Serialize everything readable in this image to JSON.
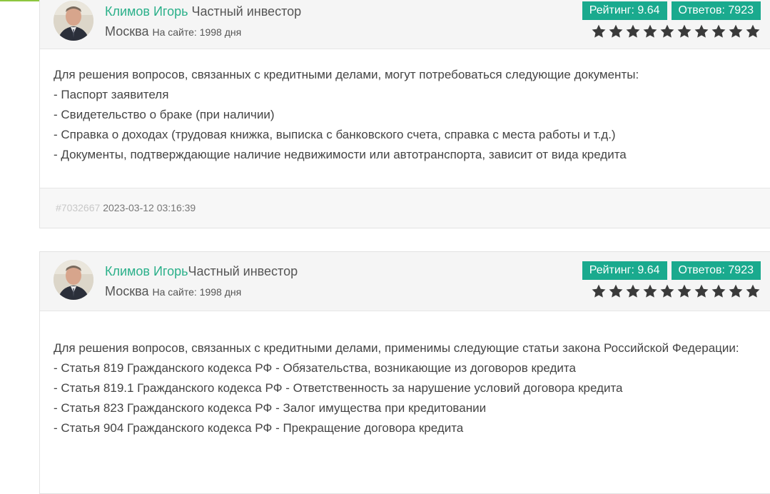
{
  "answers": [
    {
      "author": "Климов Игорь",
      "role": "Частный инвестор",
      "city": "Москва",
      "days_on_site": "На сайте: 1998 дня",
      "rating": "Рейтинг: 9.64",
      "answers_count": "Ответов: 7923",
      "stars": 10,
      "body": [
        "Для решения вопросов, связанных с кредитными делами, могут потребоваться следующие документы:",
        "- Паспорт заявителя",
        "- Свидетельство о браке (при наличии)",
        "- Справка о доходах (трудовая книжка, выписка с банковского счета, справка с места работы и т.д.)",
        "- Документы, подтверждающие наличие недвижимости или автотранспорта, зависит от вида кредита"
      ],
      "id": "#7032667",
      "date": "2023-03-12 03:16:39"
    },
    {
      "author": "Климов Игорь",
      "role": "Частный инвестор",
      "city": "Москва",
      "days_on_site": "На сайте: 1998 дня",
      "rating": "Рейтинг: 9.64",
      "answers_count": "Ответов: 7923",
      "stars": 10,
      "body": [
        "Для решения вопросов, связанных с кредитными делами, применимы следующие статьи закона Российской Федерации:",
        "- Статья 819 Гражданского кодекса РФ - Обязательства, возникающие из договоров кредита",
        "- Статья 819.1 Гражданского кодекса РФ - Ответственность за нарушение условий договора кредита",
        "- Статья 823 Гражданского кодекса РФ - Залог имущества при кредитовании",
        "- Статья 904 Гражданского кодекса РФ - Прекращение договора кредита"
      ]
    }
  ],
  "colors": {
    "accent": "#1aaa8e",
    "link": "#2bb08a",
    "star": "#3a3a3a"
  },
  "icons": {
    "star": "star-icon",
    "avatar": "avatar-photo"
  }
}
